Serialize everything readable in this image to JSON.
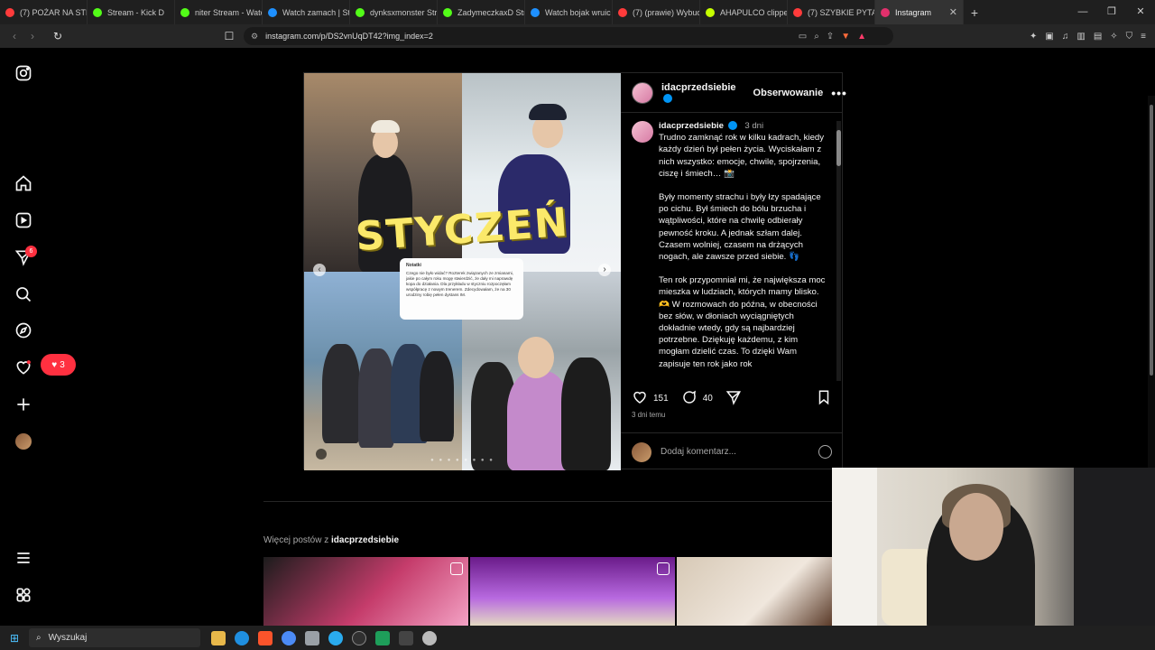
{
  "browser": {
    "tabs": [
      {
        "label": "(7) POŻAR NA STRE",
        "color": "#ff3b3b"
      },
      {
        "label": "Stream - Kick D",
        "color": "#53fc18"
      },
      {
        "label": "niter Stream - Watc",
        "color": "#53fc18"
      },
      {
        "label": "Watch zamach | Str",
        "color": "#1e90ff"
      },
      {
        "label": "dynksxmonster Stre",
        "color": "#53fc18"
      },
      {
        "label": "ZadymeczkaxD Stre",
        "color": "#53fc18"
      },
      {
        "label": "Watch bojak wruic |",
        "color": "#1e90ff"
      },
      {
        "label": "(7) (prawie) Wybuch",
        "color": "#ff3b3b"
      },
      {
        "label": "AHAPULCO clipped",
        "color": "#c6ff00"
      },
      {
        "label": "(7) SZYBKIE PYTAN",
        "color": "#ff3b3b"
      },
      {
        "label": "Instagram",
        "color": "#e1306c",
        "active": true
      }
    ],
    "url": "instagram.com/p/DS2vnUqDT42?img_index=2"
  },
  "sidebar": {
    "notifications_badge": "6",
    "likes_count": "3"
  },
  "post": {
    "username": "idacprzedsiebie",
    "follow_label": "Obserwowanie",
    "time_short": "3 dni",
    "image_title": "STYCZEŃ",
    "note": {
      "title": "Notatki",
      "text": "Czego nie było widać? Rozterek związanych ze zmianami, jakie po całym roku mogę stwierdzić, że dały mi naprawdę kopa do działania. Dla przykładu w styczniu rozpoczęłam współpracę z nowym trenerem. Zdecydowałam, że na 30 urodziny robię pełen dystans IM."
    },
    "caption": [
      "Trudno zamknąć rok w kilku kadrach, kiedy każdy dzień był pełen życia. Wyciskałam z nich wszystko: emocje, chwile, spojrzenia, ciszę i śmiech… 📸",
      "Były momenty strachu i były łzy spadające po cichu. Był śmiech do bólu brzucha i wątpliwości, które na chwilę odbierały pewność kroku. A jednak szłam dalej. Czasem wolniej, czasem na drżących nogach, ale zawsze przed siebie. 👣",
      "Ten rok przypomniał mi, że największa moc mieszka w ludziach, których mamy blisko. 🫶 W rozmowach do późna, w obecności bez słów, w dłoniach wyciągniętych dokładnie wtedy, gdy są najbardziej potrzebne. Dziękuję każdemu, z kim mogłam dzielić czas. To dzięki Wam zapisuje ten rok jako rok"
    ],
    "likes": "151",
    "comments": "40",
    "time_long": "3 dni temu",
    "comment_placeholder": "Dodaj komentarz..."
  },
  "more_posts": {
    "prefix": "Więcej postów z",
    "username": "idacprzedsiebie"
  },
  "taskbar": {
    "search_label": "Wyszukaj"
  }
}
